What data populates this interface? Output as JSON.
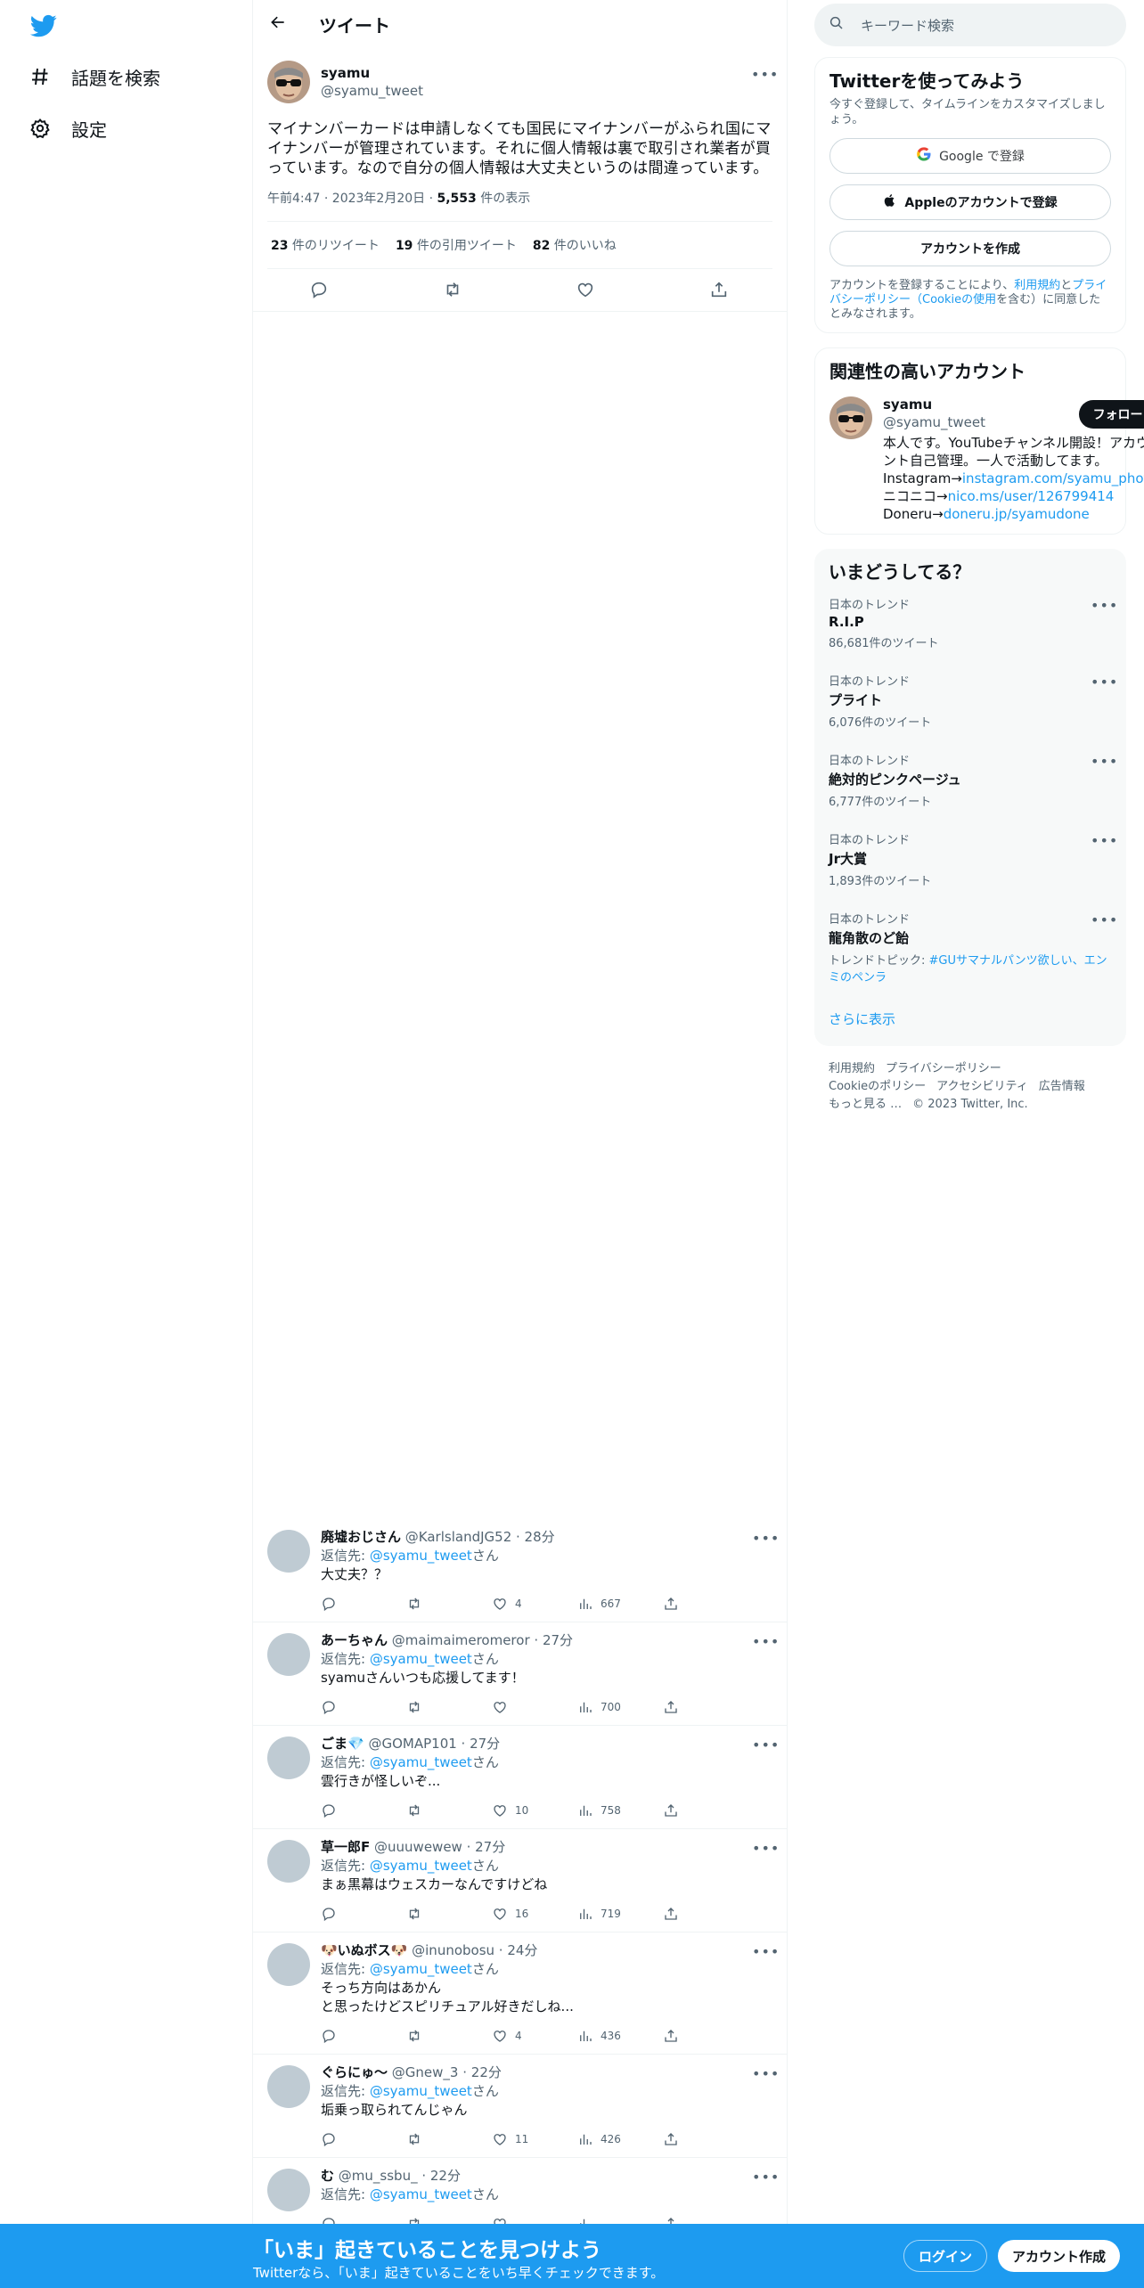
{
  "nav": {
    "explore_label": "話題を検索",
    "settings_label": "設定"
  },
  "header": {
    "title": "ツイート"
  },
  "tweet": {
    "name": "syamu",
    "handle": "@syamu_tweet",
    "text": "マイナンバーカードは申請しなくても国民にマイナンバーがふられ国にマイナンバーが管理されています。それに個人情報は裏で取引され業者が買っています。なので自分の個人情報は大丈夫というのは間違っています。",
    "time": "午前4:47 · 2023年2月20日 · ",
    "views": "5,553",
    "views_label": " 件の表示",
    "retweets": "23",
    "retweets_label": " 件のリツイート",
    "quotes": "19",
    "quotes_label": " 件の引用ツイート",
    "likes": "82",
    "likes_label": " 件のいいね"
  },
  "replies": [
    {
      "name": "廃墟おじさん",
      "handle": "@KarlslandJG52",
      "time": "28分",
      "to_prefix": "返信先: ",
      "to": "@syamu_tweet",
      "to_suffix": "さん",
      "text": "大丈夫？？",
      "likes": "4",
      "views": "667",
      "retweets": ""
    },
    {
      "name": "あーちゃん",
      "handle": "@maimaimeromeror",
      "time": "27分",
      "to_prefix": "返信先: ",
      "to": "@syamu_tweet",
      "to_suffix": "さん",
      "text": "syamuさんいつも応援してます！",
      "likes": "",
      "views": "700",
      "retweets": ""
    },
    {
      "name": "ごま💎",
      "handle": "@GOMAP101",
      "time": "27分",
      "to_prefix": "返信先: ",
      "to": "@syamu_tweet",
      "to_suffix": "さん",
      "text": "雲行きが怪しいぞ...",
      "likes": "10",
      "views": "758",
      "retweets": ""
    },
    {
      "name": "草一郎F",
      "handle": "@uuuwewew",
      "time": "27分",
      "to_prefix": "返信先: ",
      "to": "@syamu_tweet",
      "to_suffix": "さん",
      "text": "まぁ黒幕はウェスカーなんですけどね",
      "likes": "16",
      "views": "719",
      "retweets": ""
    },
    {
      "name": "🐶いぬボス🐶",
      "handle": "@inunobosu",
      "time": "24分",
      "to_prefix": "返信先: ",
      "to": "@syamu_tweet",
      "to_suffix": "さん",
      "text": "そっち方向はあかん\nと思ったけどスピリチュアル好きだしね...",
      "likes": "4",
      "views": "436",
      "retweets": ""
    },
    {
      "name": "ぐらにゅ〜",
      "handle": "@Gnew_3",
      "time": "22分",
      "to_prefix": "返信先: ",
      "to": "@syamu_tweet",
      "to_suffix": "さん",
      "text": "垢乗っ取られてんじゃん",
      "likes": "11",
      "views": "426",
      "retweets": ""
    },
    {
      "name": "む",
      "handle": "@mu_ssbu_",
      "time": "22分",
      "to_prefix": "返信先: ",
      "to": "@syamu_tweet",
      "to_suffix": "さん",
      "text": "",
      "likes": "",
      "views": "",
      "retweets": ""
    }
  ],
  "search": {
    "placeholder": "キーワード検索"
  },
  "signup": {
    "title": "Twitterを使ってみよう",
    "subtitle": "今すぐ登録して、タイムラインをカスタマイズしましょう。",
    "google": "Google で登録",
    "apple": "Appleのアカウントで登録",
    "create": "アカウントを作成",
    "legal_1": "アカウントを登録することにより、",
    "legal_terms": "利用規約",
    "legal_2": "と",
    "legal_privacy": "プライバシーポリシー",
    "legal_cookie": "（Cookieの使用",
    "legal_3": "を含む）に同意したとみなされます。"
  },
  "related": {
    "title": "関連性の高いアカウント",
    "name": "syamu",
    "handle": "@syamu_tweet",
    "follow": "フォロー",
    "bio_1": "本人です。YouTubeチャンネル開設！アカウント自己管理。一人で活動してます。 Instagram→",
    "bio_link_1": "instagram.com/syamu_photo",
    "bio_2": " ニコニコ→",
    "bio_link_2": "nico.ms/user/126799414",
    "bio_3": " Doneru→",
    "bio_link_3": "doneru.jp/syamudone"
  },
  "trends": {
    "title": "いまどうしてる？",
    "items": [
      {
        "category": "日本のトレンド",
        "name": "R.I.P",
        "count": "86,681件のツイート"
      },
      {
        "category": "日本のトレンド",
        "name": "プライト",
        "count": "6,076件のツイート"
      },
      {
        "category": "日本のトレンド",
        "name": "絶対的ピンクページュ",
        "count": "6,777件のツイート"
      },
      {
        "category": "日本のトレンド",
        "name": "Jr大賞",
        "count": "1,893件のツイート"
      },
      {
        "category": "日本のトレンド",
        "name": "龍角散のど飴",
        "count_prefix": "トレンドトピック: ",
        "count_link": "#GUサマナルパンツ欲しい、エンミのペンラ"
      }
    ],
    "show_more": "さらに表示"
  },
  "footer": {
    "terms": "利用規約",
    "privacy": "プライバシーポリシー",
    "cookie": "Cookieのポリシー",
    "accessibility": "アクセシビリティ",
    "ads": "広告情報",
    "more": "もっと見る …",
    "copyright": "© 2023 Twitter, Inc."
  },
  "bottom_bar": {
    "title": "「いま」起きていることを見つけよう",
    "subtitle": "Twitterなら、「いま」起きていることをいち早くチェックできます。",
    "login": "ログイン",
    "signup": "アカウント作成"
  },
  "colors": {
    "accent": "#1d9bf0",
    "text": "#0f1419",
    "muted": "#536471"
  }
}
